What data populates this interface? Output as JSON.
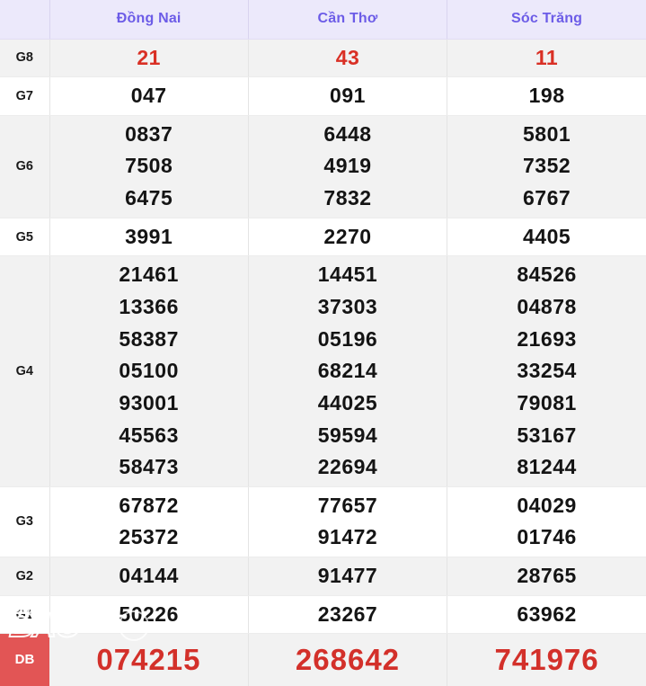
{
  "table": {
    "corner_label": "",
    "columns": [
      "Đồng Nai",
      "Cần Thơ",
      "Sóc Trăng"
    ],
    "colors": {
      "header_bg": "#ece9fb",
      "header_text": "#6c5ce7",
      "stripe_gray": "#f2f2f2",
      "stripe_white": "#ffffff",
      "g8_red": "#d93025",
      "db_label_bg": "#e25555",
      "db_number_red": "#d3302a",
      "number_black": "#141414"
    },
    "rows": [
      {
        "label": "G8",
        "dong_nai": [
          "21"
        ],
        "can_tho": [
          "43"
        ],
        "soc_trang": [
          "11"
        ]
      },
      {
        "label": "G7",
        "dong_nai": [
          "047"
        ],
        "can_tho": [
          "091"
        ],
        "soc_trang": [
          "198"
        ]
      },
      {
        "label": "G6",
        "dong_nai": [
          "0837",
          "7508",
          "6475"
        ],
        "can_tho": [
          "6448",
          "4919",
          "7832"
        ],
        "soc_trang": [
          "5801",
          "7352",
          "6767"
        ]
      },
      {
        "label": "G5",
        "dong_nai": [
          "3991"
        ],
        "can_tho": [
          "2270"
        ],
        "soc_trang": [
          "4405"
        ]
      },
      {
        "label": "G4",
        "dong_nai": [
          "21461",
          "13366",
          "58387",
          "05100",
          "93001",
          "45563",
          "58473"
        ],
        "can_tho": [
          "14451",
          "37303",
          "05196",
          "68214",
          "44025",
          "59594",
          "22694"
        ],
        "soc_trang": [
          "84526",
          "04878",
          "21693",
          "33254",
          "79081",
          "53167",
          "81244"
        ]
      },
      {
        "label": "G3",
        "dong_nai": [
          "67872",
          "25372"
        ],
        "can_tho": [
          "77657",
          "91472"
        ],
        "soc_trang": [
          "04029",
          "01746"
        ]
      },
      {
        "label": "G2",
        "dong_nai": [
          "04144"
        ],
        "can_tho": [
          "91477"
        ],
        "soc_trang": [
          "28765"
        ]
      },
      {
        "label": "G1",
        "dong_nai": [
          "50226"
        ],
        "can_tho": [
          "23267"
        ],
        "soc_trang": [
          "63962"
        ]
      },
      {
        "label": "DB",
        "dong_nai": [
          "074215"
        ],
        "can_tho": [
          "268642"
        ],
        "soc_trang": [
          "741976"
        ]
      }
    ]
  },
  "watermark": {
    "primary": "BAO",
    "secondary": "DB"
  }
}
